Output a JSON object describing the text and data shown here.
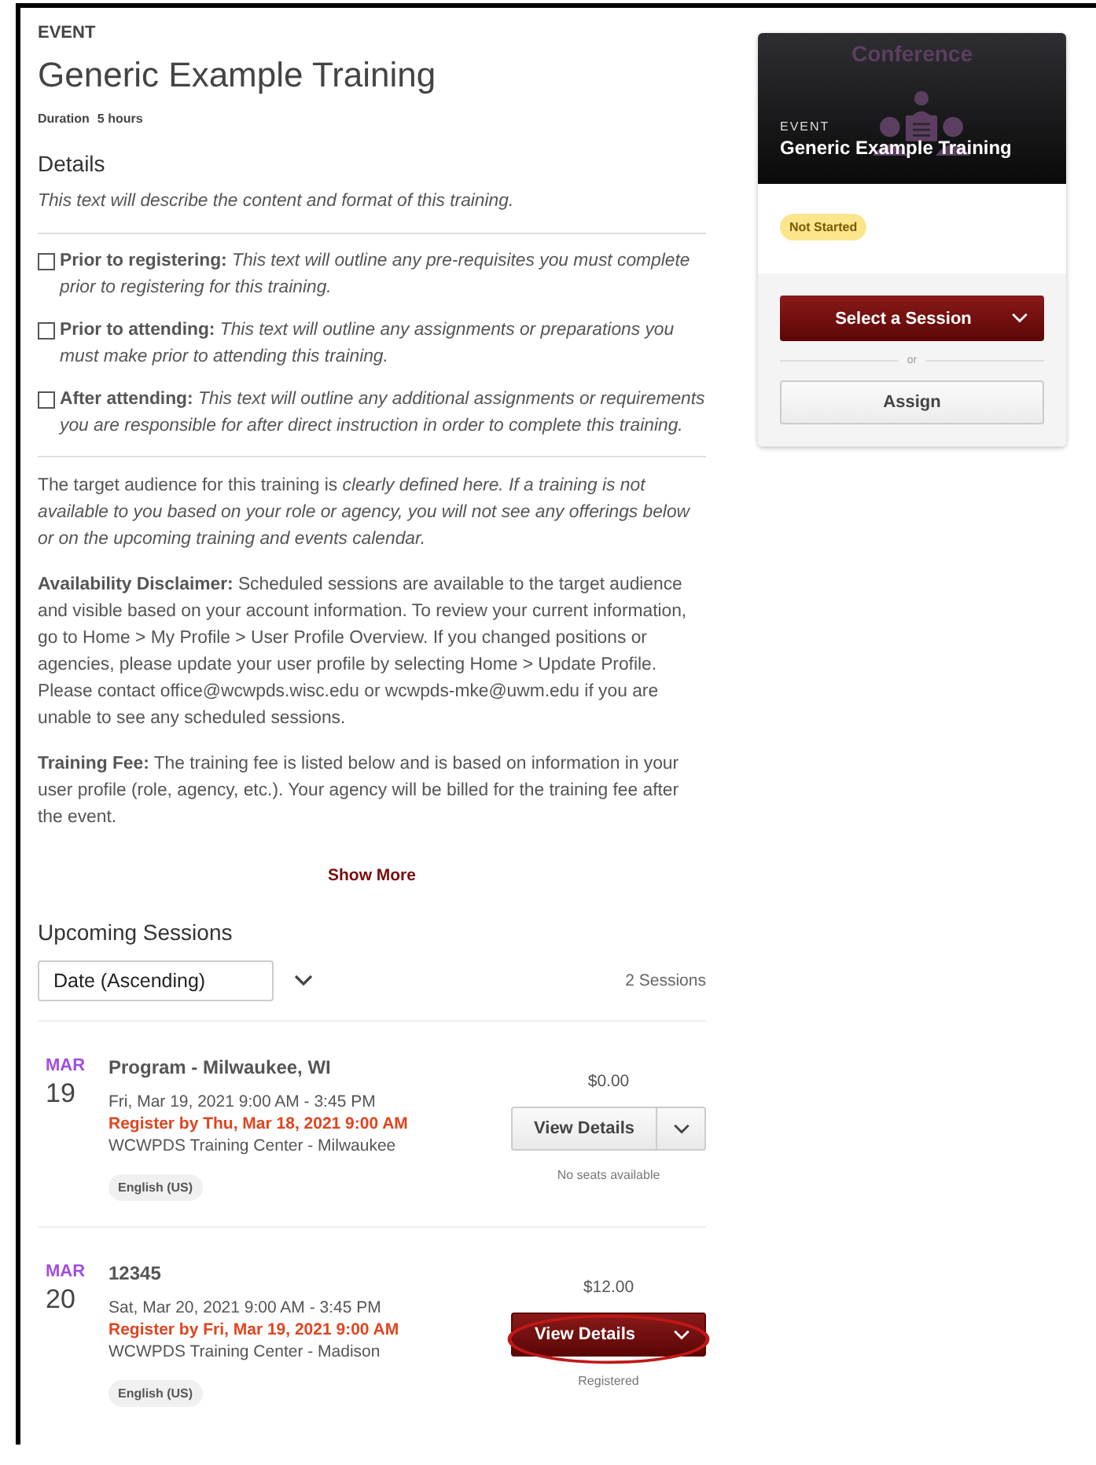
{
  "header": {
    "eyebrow": "EVENT",
    "title": "Generic Example Training",
    "duration_label": "Duration",
    "duration_value": "5 hours"
  },
  "details": {
    "heading": "Details",
    "intro": "This text will describe the content and format of this training.",
    "checklist": [
      {
        "text": "**Prior to registering:** *This text will outline any pre-requisites you must complete prior to registering for this training.*",
        "checked": false
      },
      {
        "text": "**Prior to attending:** *This text will outline any assignments or preparations you must make prior to attending this training.*",
        "checked": false
      },
      {
        "text": "**After attending:** *This text will outline any additional assignments or requirements you are responsible for after direct instruction in order to complete this training.*",
        "checked": false
      }
    ],
    "paragraphs": [
      "The target audience for this training is *clearly defined here. If a training is not available to you based on your role or agency, you will not see any offerings below or on the upcoming training and events calendar.*",
      "**Availability Disclaimer:** Scheduled sessions are available to the target audience and visible based on your account information. To review your current information, go to Home > My Profile > User Profile Overview. If you changed positions or agencies, please update your user profile by selecting Home > Update Profile. Please contact office@wcwpds.wisc.edu or wcwpds-mke@uwm.edu if you are unable to see any scheduled sessions.",
      "**Training Fee:** The training fee is listed below and is based on information in your user profile (role, agency, etc.). Your agency will be billed for the training fee after the event."
    ],
    "show_more": "Show More"
  },
  "sessions": {
    "heading": "Upcoming Sessions",
    "sort_value": "Date (Ascending)",
    "count": "2 Sessions",
    "items": [
      {
        "month": "MAR",
        "day": "19",
        "title": "Program - Milwaukee, WI",
        "when": "Fri, Mar 19, 2021 9:00 AM - 3:45 PM",
        "deadline": "Register by Thu, Mar 18, 2021 9:00 AM",
        "location": "WCWPDS Training Center - Milwaukee",
        "language": "English (US)",
        "price": "$0.00",
        "button": "View Details",
        "kind": "secondary",
        "status": "No seats available",
        "highlighted": false
      },
      {
        "month": "MAR",
        "day": "20",
        "title": "12345",
        "when": "Sat, Mar 20, 2021 9:00 AM - 3:45 PM",
        "deadline": "Register by Fri, Mar 19, 2021 9:00 AM",
        "location": "WCWPDS Training Center - Madison",
        "language": "English (US)",
        "price": "$12.00",
        "button": "View Details",
        "kind": "primary",
        "status": "Registered",
        "highlighted": true
      }
    ]
  },
  "card": {
    "banner_label": "Conference",
    "eyebrow": "EVENT",
    "title": "Generic Example Training",
    "status": "Not Started",
    "select_button": "Select a Session",
    "divider": "or",
    "assign_button": "Assign"
  }
}
